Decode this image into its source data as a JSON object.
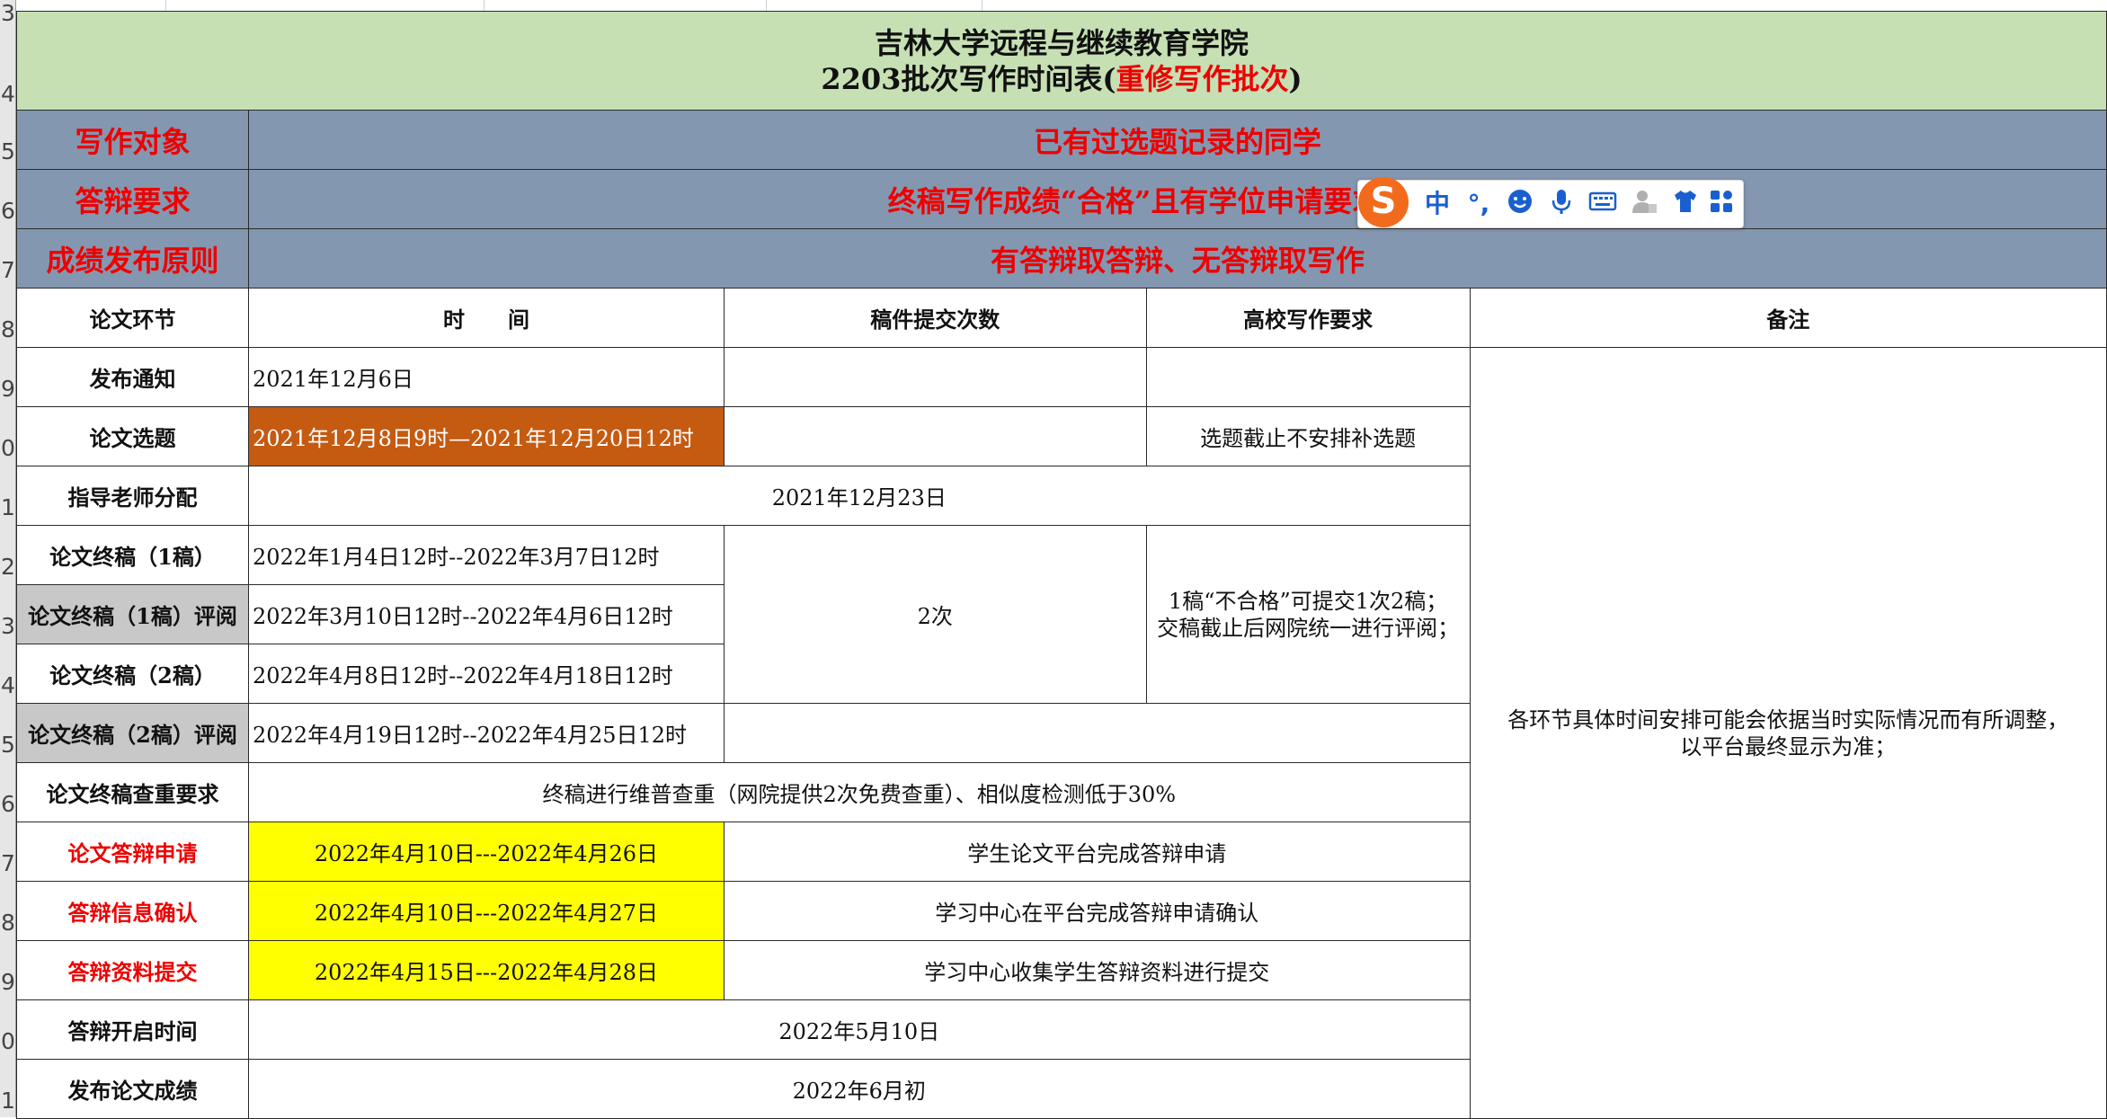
{
  "title": {
    "line1": "吉林大学远程与继续教育学院",
    "line2_black": "2203批次写作时间表(",
    "line2_red": "重修写作批次",
    "line2_end": ")"
  },
  "row_numbers": [
    "3",
    "4",
    "5",
    "6",
    "7",
    "8",
    "9",
    "0",
    "1",
    "2",
    "3",
    "4",
    "5",
    "6",
    "7",
    "8",
    "9",
    "0",
    "1"
  ],
  "bands": [
    {
      "label": "写作对象",
      "value": "已有过选题记录的同学"
    },
    {
      "label": "答辩要求",
      "value": "终稿写作成绩“合格”且有学位申请要求的同学"
    },
    {
      "label": "成绩发布原则",
      "value": "有答辩取答辩、无答辩取写作"
    }
  ],
  "headers": {
    "stage": "论文环节",
    "time": "时　　间",
    "submissions": "稿件提交次数",
    "school_req": "高校写作要求",
    "remarks": "备注"
  },
  "rows": {
    "notice": {
      "label": "发布通知",
      "time": "2021年12月6日"
    },
    "topic": {
      "label": "论文选题",
      "time": "2021年12月8日9时—2021年12月20日12时",
      "req": "选题截止不安排补选题"
    },
    "advisor": {
      "label": "指导老师分配",
      "value": "2021年12月23日"
    },
    "final1": {
      "label": "论文终稿（1稿）",
      "time": "2022年1月4日12时--2022年3月7日12时"
    },
    "review1": {
      "label": "论文终稿（1稿）评阅",
      "time": "2022年3月10日12时--2022年4月6日12时"
    },
    "final2": {
      "label": "论文终稿（2稿）",
      "time": "2022年4月8日12时--2022年4月18日12时"
    },
    "review2": {
      "label": "论文终稿（2稿）评阅",
      "time": "2022年4月19日12时--2022年4月25日12时"
    },
    "dup_check": {
      "label": "论文终稿查重要求",
      "value": "终稿进行维普查重（网院提供2次免费查重）、相似度检测低于30%"
    },
    "defense_apply": {
      "label": "论文答辩申请",
      "time": "2022年4月10日---2022年4月26日",
      "note": "学生论文平台完成答辩申请"
    },
    "defense_confirm": {
      "label": "答辩信息确认",
      "time": "2022年4月10日---2022年4月27日",
      "note": "学习中心在平台完成答辩申请确认"
    },
    "defense_submit": {
      "label": "答辩资料提交",
      "time": "2022年4月15日---2022年4月28日",
      "note": "学习中心收集学生答辩资料进行提交"
    },
    "defense_open": {
      "label": "答辩开启时间",
      "value": "2022年5月10日"
    },
    "grades": {
      "label": "发布论文成绩",
      "value": "2022年6月初"
    }
  },
  "merged": {
    "submissions_count": "2次",
    "school_req_line1": "1稿“不合格”可提交1次2稿；",
    "school_req_line2": "交稿截止后网院统一进行评阅；",
    "remark_line1": "各环节具体时间安排可能会依据当时实际情况而有所调整，",
    "remark_line2": "以平台最终显示为准；"
  },
  "ime_toolbar": {
    "logo": "S",
    "lang": "中",
    "punct": "°,",
    "icons": [
      "emoji-icon",
      "microphone-icon",
      "keyboard-icon",
      "user-icon",
      "skin-icon",
      "apps-icon"
    ]
  }
}
